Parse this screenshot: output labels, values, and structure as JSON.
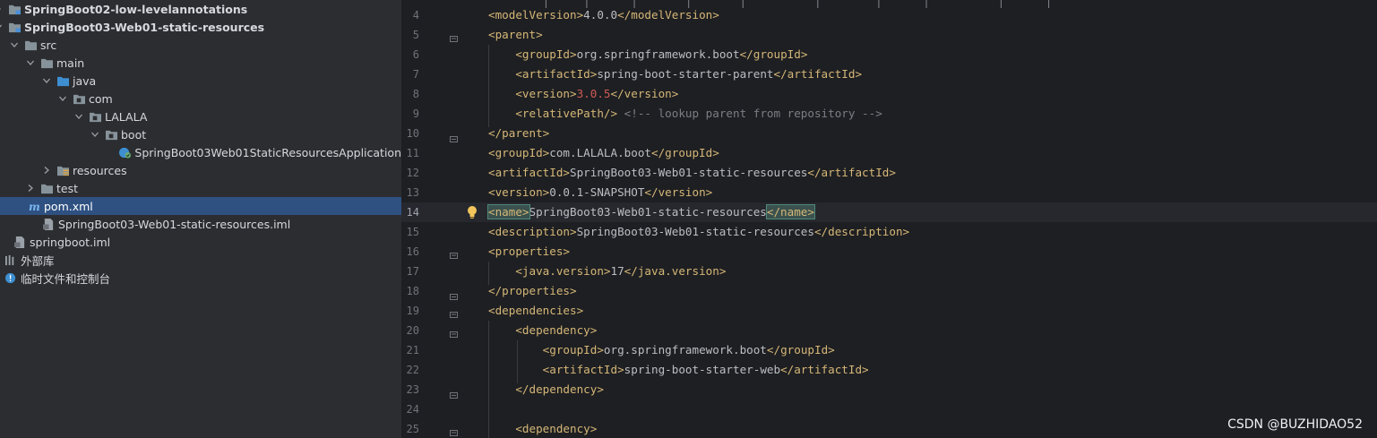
{
  "project_tree": {
    "items": [
      {
        "label": "SpringBoot02-low-levelannotations",
        "icon": "module-folder-icon",
        "arrow": "right",
        "bold": true
      },
      {
        "label": "SpringBoot03-Web01-static-resources",
        "icon": "module-folder-icon",
        "arrow": "down",
        "bold": true
      },
      {
        "label": "src",
        "icon": "folder-icon",
        "arrow": "down"
      },
      {
        "label": "main",
        "icon": "folder-icon",
        "arrow": "down"
      },
      {
        "label": "java",
        "icon": "source-folder-icon",
        "arrow": "down"
      },
      {
        "label": "com",
        "icon": "package-icon",
        "arrow": "down"
      },
      {
        "label": "LALALA",
        "icon": "package-icon",
        "arrow": "down"
      },
      {
        "label": "boot",
        "icon": "package-icon",
        "arrow": "down"
      },
      {
        "label": "SpringBoot03Web01StaticResourcesApplication",
        "icon": "spring-boot-class-icon",
        "arrow": "none"
      },
      {
        "label": "resources",
        "icon": "resources-folder-icon",
        "arrow": "right"
      },
      {
        "label": "test",
        "icon": "folder-icon",
        "arrow": "right"
      },
      {
        "label": "pom.xml",
        "icon": "maven-icon",
        "arrow": "none",
        "selected": true
      },
      {
        "label": "SpringBoot03-Web01-static-resources.iml",
        "icon": "iml-file-icon",
        "arrow": "none"
      },
      {
        "label": "springboot.iml",
        "icon": "iml-file-icon",
        "arrow": "none"
      },
      {
        "label": "外部库",
        "icon": "library-icon",
        "arrow": "none"
      },
      {
        "label": "临时文件和控制台",
        "icon": "scratch-icon",
        "arrow": "none"
      }
    ]
  },
  "editor": {
    "top_cut_text": "        |     |      |       |       |          |        |      |          |      |",
    "lines": [
      {
        "num": "4",
        "parts": [
          [
            "tag",
            "<modelVersion>"
          ],
          [
            "txt",
            "4.0.0"
          ],
          [
            "tag",
            "</modelVersion>"
          ]
        ]
      },
      {
        "num": "5",
        "parts": [
          [
            "tag",
            "<parent>"
          ]
        ]
      },
      {
        "num": "6",
        "parts": [
          [
            "txt",
            "    "
          ],
          [
            "tag",
            "<groupId>"
          ],
          [
            "txt",
            "org.springframework.boot"
          ],
          [
            "tag",
            "</groupId>"
          ]
        ]
      },
      {
        "num": "7",
        "parts": [
          [
            "txt",
            "    "
          ],
          [
            "tag",
            "<artifactId>"
          ],
          [
            "txt",
            "spring-boot-starter-parent"
          ],
          [
            "tag",
            "</artifactId>"
          ]
        ]
      },
      {
        "num": "8",
        "parts": [
          [
            "txt",
            "    "
          ],
          [
            "tag",
            "<version>"
          ],
          [
            "ver",
            "3.0.5"
          ],
          [
            "tag",
            "</version>"
          ]
        ]
      },
      {
        "num": "9",
        "parts": [
          [
            "txt",
            "    "
          ],
          [
            "tag",
            "<relativePath/>"
          ],
          [
            "txt",
            " "
          ],
          [
            "cmt",
            "<!-- lookup parent from repository -->"
          ]
        ]
      },
      {
        "num": "10",
        "parts": [
          [
            "tag",
            "</parent>"
          ]
        ]
      },
      {
        "num": "11",
        "parts": [
          [
            "tag",
            "<groupId>"
          ],
          [
            "txt",
            "com.LALALA.boot"
          ],
          [
            "tag",
            "</groupId>"
          ]
        ]
      },
      {
        "num": "12",
        "parts": [
          [
            "tag",
            "<artifactId>"
          ],
          [
            "txt",
            "SpringBoot03-Web01-static-resources"
          ],
          [
            "tag",
            "</artifactId>"
          ]
        ]
      },
      {
        "num": "13",
        "parts": [
          [
            "tag",
            "<version>"
          ],
          [
            "txt",
            "0.0.1-SNAPSHOT"
          ],
          [
            "tag",
            "</version>"
          ]
        ]
      },
      {
        "num": "14",
        "parts": [
          [
            "hl-tag",
            "<name>"
          ],
          [
            "txt",
            "SpringBoot03-Web01-static-resources"
          ],
          [
            "hl-tag",
            "</name>"
          ]
        ]
      },
      {
        "num": "15",
        "parts": [
          [
            "tag",
            "<description>"
          ],
          [
            "txt",
            "SpringBoot03-Web01-static-resources"
          ],
          [
            "tag",
            "</description>"
          ]
        ]
      },
      {
        "num": "16",
        "parts": [
          [
            "tag",
            "<properties>"
          ]
        ]
      },
      {
        "num": "17",
        "parts": [
          [
            "txt",
            "    "
          ],
          [
            "tag",
            "<java.version>"
          ],
          [
            "txt",
            "17"
          ],
          [
            "tag",
            "</java.version>"
          ]
        ]
      },
      {
        "num": "18",
        "parts": [
          [
            "tag",
            "</properties>"
          ]
        ]
      },
      {
        "num": "19",
        "parts": [
          [
            "tag",
            "<dependencies>"
          ]
        ]
      },
      {
        "num": "20",
        "parts": [
          [
            "txt",
            "    "
          ],
          [
            "tag",
            "<dependency>"
          ]
        ]
      },
      {
        "num": "21",
        "parts": [
          [
            "txt",
            "        "
          ],
          [
            "tag",
            "<groupId>"
          ],
          [
            "txt",
            "org.springframework.boot"
          ],
          [
            "tag",
            "</groupId>"
          ]
        ]
      },
      {
        "num": "22",
        "parts": [
          [
            "txt",
            "        "
          ],
          [
            "tag",
            "<artifactId>"
          ],
          [
            "txt",
            "spring-boot-starter-web"
          ],
          [
            "tag",
            "</artifactId>"
          ]
        ]
      },
      {
        "num": "23",
        "parts": [
          [
            "txt",
            "    "
          ],
          [
            "tag",
            "</dependency>"
          ]
        ]
      },
      {
        "num": "24",
        "parts": []
      },
      {
        "num": "25",
        "parts": [
          [
            "txt",
            "    "
          ],
          [
            "tag",
            "<dependency>"
          ]
        ]
      }
    ]
  },
  "watermark": "CSDN @BUZHIDAO52",
  "colors": {
    "sidebar_bg": "#2b2d30",
    "editor_bg": "#1e1f22",
    "selection": "#2f5182",
    "xml_tag": "#d5b778",
    "text": "#bcbec4",
    "number_red": "#cf5b56",
    "comment": "#7a7e85"
  }
}
